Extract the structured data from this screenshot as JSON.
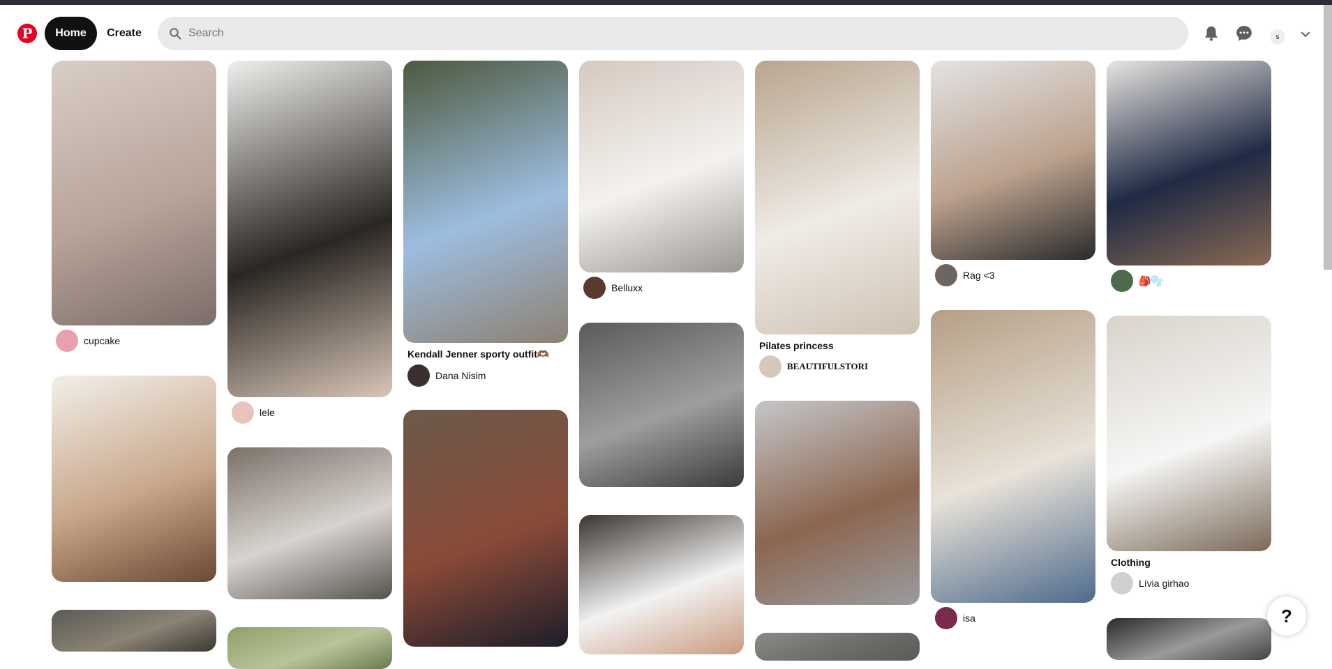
{
  "header": {
    "logo_letter": "P",
    "home_label": "Home",
    "create_label": "Create",
    "search_placeholder": "Search",
    "avatar_initial": "s",
    "icons": [
      "pinterest-logo-icon",
      "search-icon",
      "bell-icon",
      "message-icon",
      "chevron-down-icon"
    ]
  },
  "colors": {
    "brand": "#e60023",
    "home_bg": "#111111",
    "search_bg": "#e9e9e9"
  },
  "columns": [
    {
      "pins": [
        {
          "title": "",
          "user": "cupcake",
          "img_colors": [
            "#d9cdc7",
            "#b8a49a",
            "#7c6d69"
          ],
          "av": "#e8a0b0"
        },
        {
          "title": "",
          "user": "",
          "img_colors": [
            "#f2efe9",
            "#c9a88c",
            "#6b4a33"
          ],
          "av": ""
        },
        {
          "title": "",
          "user": "",
          "img_colors": [
            "#5a5a55",
            "#8b8375",
            "#3a3833"
          ],
          "av": ""
        }
      ]
    },
    {
      "pins": [
        {
          "title": "",
          "user": "lele",
          "img_colors": [
            "#f0efed",
            "#2a2622",
            "#d8c6b8"
          ],
          "av": "#e9c3bc"
        },
        {
          "title": "",
          "user": "",
          "img_colors": [
            "#7a7168",
            "#d8d3cf",
            "#55514b"
          ],
          "av": ""
        },
        {
          "title": "",
          "user": "",
          "img_colors": [
            "#8fa06a",
            "#b9c39a",
            "#6a7a4e"
          ],
          "av": ""
        }
      ]
    },
    {
      "pins": [
        {
          "title": "Kendall Jenner sporty outfit🫶🏾",
          "user": "Dana Nisim",
          "img_colors": [
            "#4d5a3e",
            "#9dbde0",
            "#8c8172"
          ],
          "av": "#3a3030"
        },
        {
          "title": "",
          "user": "",
          "img_colors": [
            "#6b5a4b",
            "#8a4a38",
            "#1d1e2a"
          ],
          "av": ""
        }
      ]
    },
    {
      "pins": [
        {
          "title": "",
          "user": "Belluxx",
          "img_colors": [
            "#d5c9c0",
            "#f4f2ef",
            "#9b9792"
          ],
          "av": "#5b3a2e"
        },
        {
          "title": "",
          "user": "",
          "img_colors": [
            "#5a5a5a",
            "#9e9e9e",
            "#3b3b3b"
          ],
          "av": ""
        },
        {
          "title": "",
          "user": "",
          "img_colors": [
            "#3b3530",
            "#f2f2f2",
            "#c99c7f"
          ],
          "av": ""
        }
      ]
    },
    {
      "pins": [
        {
          "title": "Pilates princess",
          "user": "BEAUTIFULSTORI",
          "img_colors": [
            "#b8a58e",
            "#efebe6",
            "#cfc2b3"
          ],
          "av": "#d4c8ba"
        },
        {
          "title": "",
          "user": "",
          "img_colors": [
            "#c5c6c8",
            "#8c6650",
            "#9a9b9e"
          ],
          "av": ""
        },
        {
          "title": "",
          "user": "",
          "img_colors": [
            "#8a8a86",
            "#6c6c68",
            "#5a5a56"
          ],
          "av": ""
        }
      ]
    },
    {
      "pins": [
        {
          "title": "",
          "user": "Rag <3",
          "img_colors": [
            "#e3e3e3",
            "#bca28e",
            "#2a2a2a"
          ],
          "av": "#6d6560"
        },
        {
          "title": "",
          "user": "isa",
          "img_colors": [
            "#b59f86",
            "#e8e2d8",
            "#4e6b8c"
          ],
          "av": "#7a2a4a"
        }
      ]
    },
    {
      "pins": [
        {
          "title": "",
          "user": "🎒🫧",
          "img_colors": [
            "#e8e5e1",
            "#1f2a44",
            "#8a6a52"
          ],
          "av": "#4d6b4a"
        },
        {
          "title": "Clothing",
          "user": "Lívia girhao",
          "img_colors": [
            "#d9d3cb",
            "#f6f6f5",
            "#7a6a58"
          ],
          "av": "#d0d0d0"
        },
        {
          "title": "",
          "user": "",
          "img_colors": [
            "#2a2a2a",
            "#9a9a9a",
            "#444"
          ],
          "av": ""
        }
      ]
    }
  ],
  "help_label": "?"
}
